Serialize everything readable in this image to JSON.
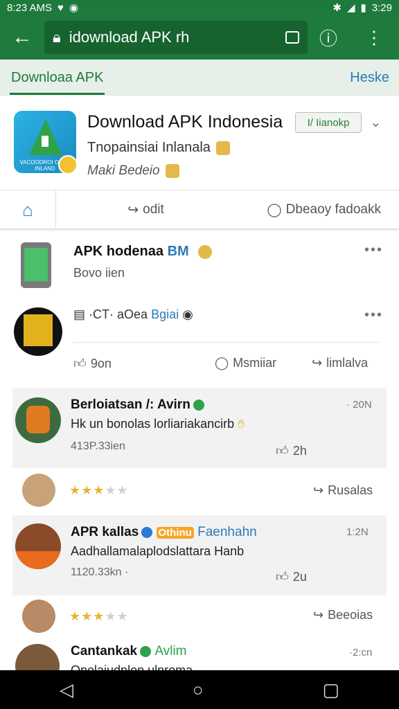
{
  "status": {
    "time": "8:23 AMS",
    "battery": "3:29"
  },
  "browser": {
    "url": "idownload APK rh"
  },
  "tabs": {
    "active": "Downloaa APK",
    "right": "Heske"
  },
  "page": {
    "title": "Download APK Indonesia",
    "follow_label": "I/ Iianokp",
    "subtitle1": "Tnopainsiai Inlanala",
    "subtitle2": "Maki Bedeio",
    "icon_text": "VACOODROI OBAN INLAND",
    "actions": {
      "share": "odit",
      "message": "Dbeaoy fadoakk"
    }
  },
  "posts": [
    {
      "name": "APK hodenaa",
      "tag": "BM",
      "sub": "Bovo iien"
    },
    {
      "caption": "·CT· aOea",
      "tag": "Bgiai",
      "actions": {
        "like": "9on",
        "comment": "Msmiiar",
        "share": "limlalva"
      }
    }
  ],
  "comments": [
    {
      "name": "Berloiatsan /: Avirn",
      "text": "Hk un bonolas lorliariakancirb",
      "meta": "413P.33ien",
      "likes": "2h",
      "time": "· 20N"
    },
    {
      "name": "APR kallas",
      "badge": "Othinu",
      "extra": "Faenhahn",
      "text": "Aadhallamalaplodslattara Hanb",
      "meta": "1120.33kn ·",
      "likes": "2u",
      "time": "1:2N"
    },
    {
      "name": "Cantankak",
      "extra": "Avlim",
      "text": "Onolaiudplon ulnroma",
      "time": "·2:cn"
    }
  ],
  "ratings": [
    {
      "stars": 3.5,
      "share_label": "Rusalas"
    },
    {
      "stars": 3.5,
      "share_label": "Beeoias"
    }
  ],
  "colors": {
    "brand_green": "#1f7b3d",
    "link_blue": "#2a7ab8",
    "star": "#e6b52e"
  }
}
